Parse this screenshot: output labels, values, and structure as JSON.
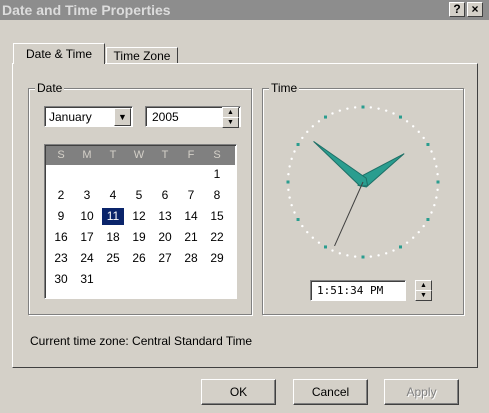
{
  "window": {
    "title": "Date and Time Properties",
    "help_label": "?",
    "close_label": "×"
  },
  "tabs": [
    {
      "label": "Date & Time",
      "active": true
    },
    {
      "label": "Time Zone",
      "active": false
    }
  ],
  "date_group": {
    "label": "Date",
    "month": "January",
    "year": "2005",
    "weekdays": [
      "S",
      "M",
      "T",
      "W",
      "T",
      "F",
      "S"
    ],
    "weeks": [
      [
        "",
        "",
        "",
        "",
        "",
        "",
        "1"
      ],
      [
        "2",
        "3",
        "4",
        "5",
        "6",
        "7",
        "8"
      ],
      [
        "9",
        "10",
        "11",
        "12",
        "13",
        "14",
        "15"
      ],
      [
        "16",
        "17",
        "18",
        "19",
        "20",
        "21",
        "22"
      ],
      [
        "23",
        "24",
        "25",
        "26",
        "27",
        "28",
        "29"
      ],
      [
        "30",
        "31",
        "",
        "",
        "",
        "",
        ""
      ]
    ],
    "selected_day": "11"
  },
  "time_group": {
    "label": "Time",
    "time_value": "1:51:34 PM",
    "clock": {
      "hour": 13,
      "minute": 51,
      "second": 34
    }
  },
  "timezone_text": "Current time zone:  Central Standard Time",
  "buttons": {
    "ok": "OK",
    "cancel": "Cancel",
    "apply": "Apply"
  },
  "colors": {
    "face": "#d4d0c8",
    "selection": "#0a246a",
    "clock_hand": "#2a9d8f",
    "title_inactive": "#8d8d8d"
  }
}
